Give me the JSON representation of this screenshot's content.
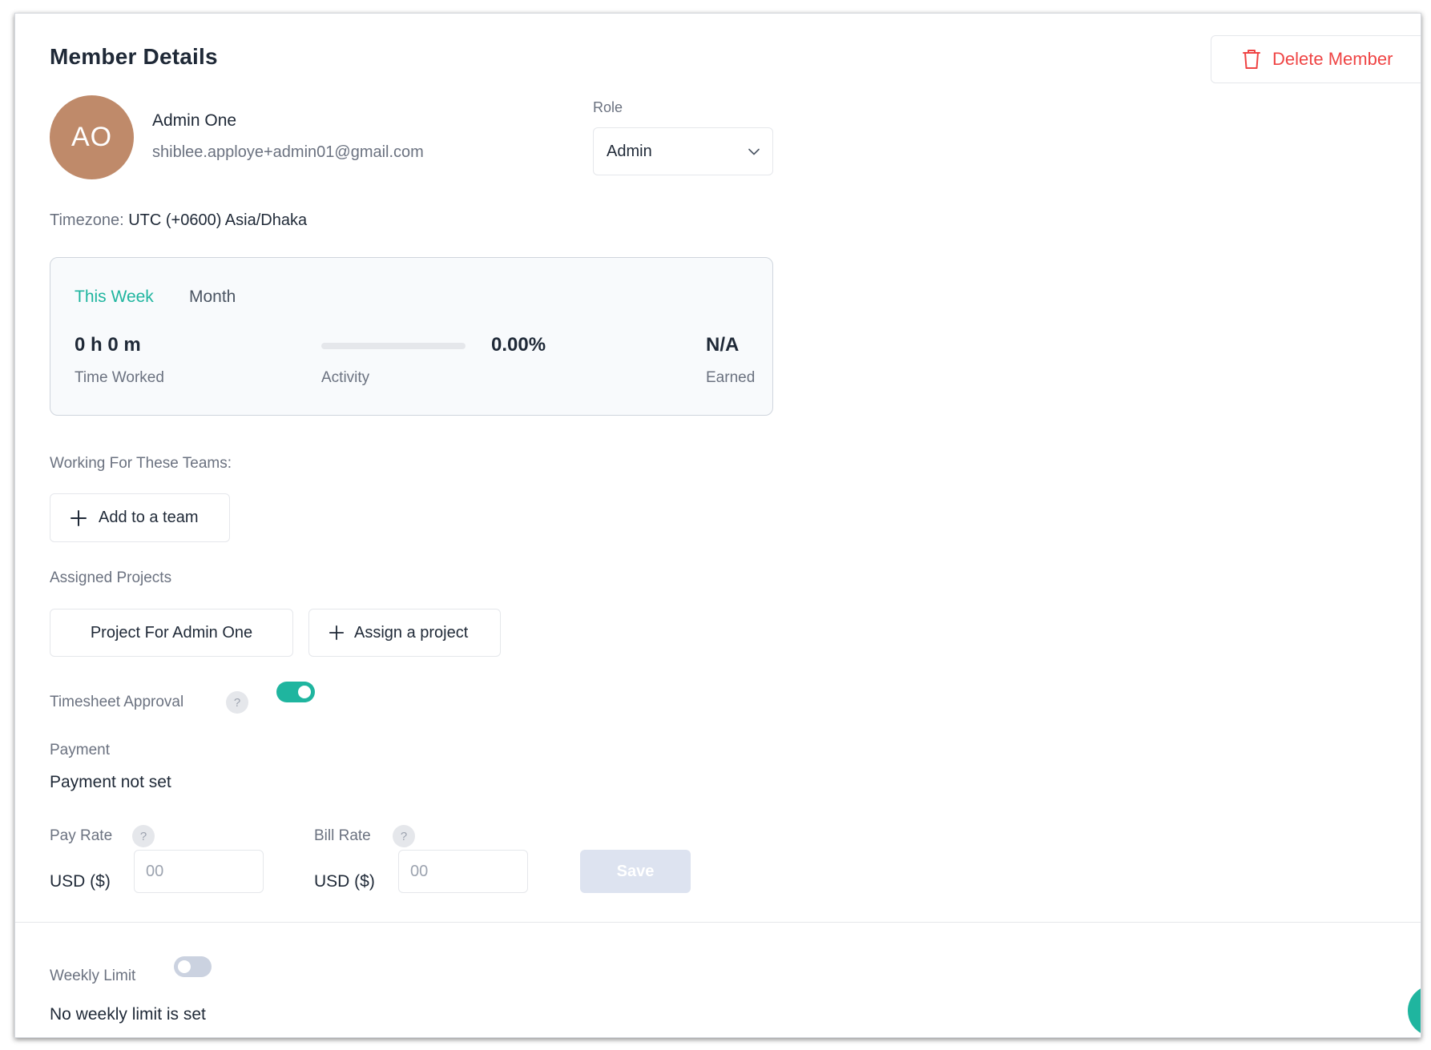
{
  "header": {
    "title": "Member Details",
    "delete_label": "Delete Member"
  },
  "member": {
    "initials": "AO",
    "name": "Admin One",
    "email": "shiblee.apploye+admin01@gmail.com"
  },
  "role": {
    "label": "Role",
    "selected": "Admin"
  },
  "timezone": {
    "label": "Timezone:",
    "value": "UTC (+0600) Asia/Dhaka"
  },
  "stats": {
    "tabs": {
      "week": "This Week",
      "month": "Month"
    },
    "time_worked_value": "0 h 0 m",
    "time_worked_label": "Time Worked",
    "activity_label": "Activity",
    "activity_value": "0.00%",
    "activity_fraction": 0,
    "earned_value": "N/A",
    "earned_label": "Earned"
  },
  "teams": {
    "label": "Working For These Teams:",
    "add_label": "Add to a team"
  },
  "projects": {
    "label": "Assigned Projects",
    "items": [
      "Project For Admin One"
    ],
    "assign_label": "Assign a project"
  },
  "timesheet": {
    "label": "Timesheet Approval",
    "help": "?",
    "enabled": true
  },
  "payment": {
    "label": "Payment",
    "status": "Payment not set"
  },
  "pay_rate": {
    "label": "Pay Rate",
    "help": "?",
    "currency": "USD ($)",
    "placeholder": "00"
  },
  "bill_rate": {
    "label": "Bill Rate",
    "help": "?",
    "currency": "USD ($)",
    "placeholder": "00"
  },
  "save_label": "Save",
  "weekly_limit": {
    "label": "Weekly Limit",
    "enabled": false,
    "status": "No weekly limit is set"
  },
  "colors": {
    "accent": "#1fb59f",
    "danger": "#ef4444",
    "avatar": "#bf8a6a"
  },
  "icons": {
    "delete": "trash-icon",
    "role_dropdown": "chevron-down-icon",
    "add": "plus-icon",
    "help": "help-icon"
  }
}
